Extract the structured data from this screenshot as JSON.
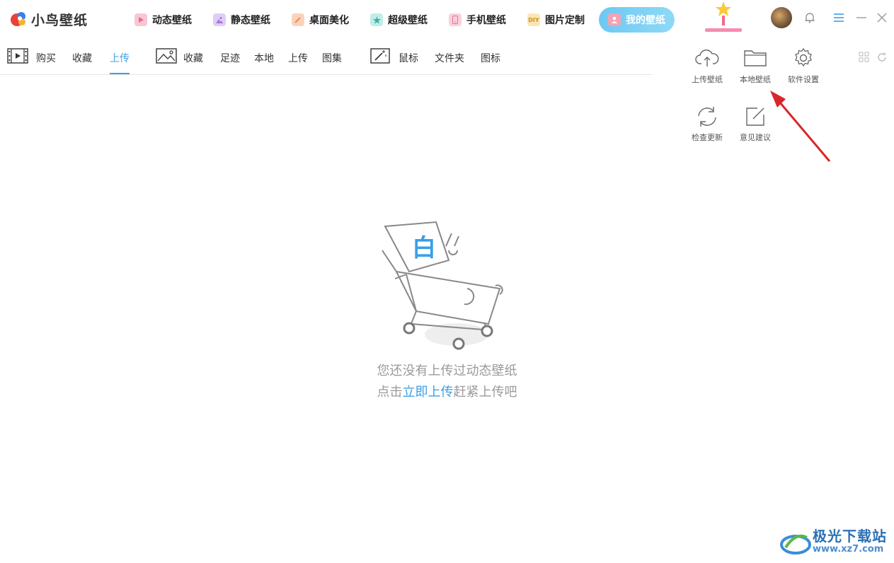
{
  "app": {
    "name": "小鸟壁纸"
  },
  "top_tabs": [
    {
      "label": "动态壁纸",
      "icon": "play-icon",
      "color": "#f7a8c0"
    },
    {
      "label": "静态壁纸",
      "icon": "image-icon",
      "color": "#c9a7ef"
    },
    {
      "label": "桌面美化",
      "icon": "brush-icon",
      "color": "#f6a77d"
    },
    {
      "label": "超级壁纸",
      "icon": "star-icon",
      "color": "#6ccfc4"
    },
    {
      "label": "手机壁纸",
      "icon": "phone-icon",
      "color": "#f5a6bd"
    },
    {
      "label": "图片定制",
      "icon": "diy-icon",
      "icon_text": "DIY",
      "color": "#f7d47d"
    },
    {
      "label": "我的壁纸",
      "icon": "user-icon",
      "color": "#f3a3b3",
      "active": true
    }
  ],
  "sub_nav": {
    "group1": [
      "购买",
      "收藏",
      "上传"
    ],
    "group2": [
      "收藏",
      "足迹",
      "本地",
      "上传",
      "图集"
    ],
    "group3": [
      "鼠标",
      "文件夹",
      "图标"
    ],
    "active": "上传"
  },
  "menu": {
    "items": [
      {
        "label": "上传壁纸",
        "icon": "cloud-upload-icon"
      },
      {
        "label": "本地壁纸",
        "icon": "folder-icon"
      },
      {
        "label": "软件设置",
        "icon": "gear-icon"
      },
      {
        "label": "检查更新",
        "icon": "refresh-icon"
      },
      {
        "label": "意见建议",
        "icon": "edit-icon"
      }
    ]
  },
  "empty_state": {
    "illustration_text": "白",
    "line1": "您还没有上传过动态壁纸",
    "line2_prefix": "点击",
    "line2_link": "立即上传",
    "line2_suffix": "赶紧上传吧"
  },
  "watermark": {
    "line1": "极光下载站",
    "line2": "www.xz7.com"
  },
  "colors": {
    "accent": "#3aa0e8",
    "active_tab": "#6cc9f3",
    "arrow": "#d9262c"
  }
}
